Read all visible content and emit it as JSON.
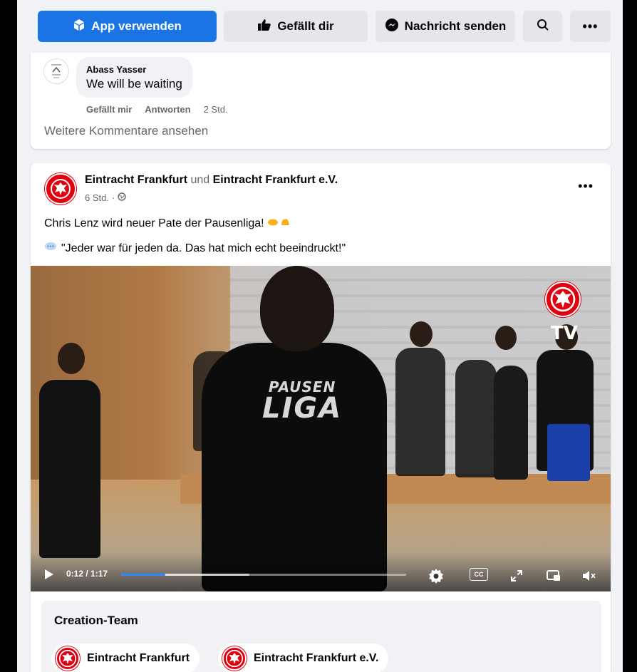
{
  "topbar": {
    "use_app_label": "App verwenden",
    "like_label": "Gefällt dir",
    "message_label": "Nachricht senden"
  },
  "comment": {
    "author": "Abass Yasser",
    "text": "We will be waiting",
    "like_action": "Gefällt mir",
    "reply_action": "Antworten",
    "time": "2 Std.",
    "more_comments": "Weitere Kommentare ansehen"
  },
  "post": {
    "author_primary": "Eintracht Frankfurt",
    "joiner": "und",
    "author_secondary": "Eintracht Frankfurt e.V.",
    "time": "6 Std.",
    "line1": "Chris Lenz wird neuer Pate der Pausenliga!",
    "line2": "\"Jeder war für jeden da. Das hat mich echt beeindruckt!\"",
    "video": {
      "shirt_top": "PAUSEN",
      "shirt_bottom": "LIGA",
      "tv_label": "TV",
      "time_display": "0:12 / 1:17",
      "progress_fraction": 0.156,
      "buffered_fraction": 0.45
    }
  },
  "creation_team": {
    "title": "Creation-Team",
    "members": [
      "Eintracht Frankfurt",
      "Eintracht Frankfurt e.V."
    ]
  },
  "colors": {
    "primary": "#1b74e4",
    "brand_red": "#e1000f",
    "progress": "#2d88ff"
  }
}
